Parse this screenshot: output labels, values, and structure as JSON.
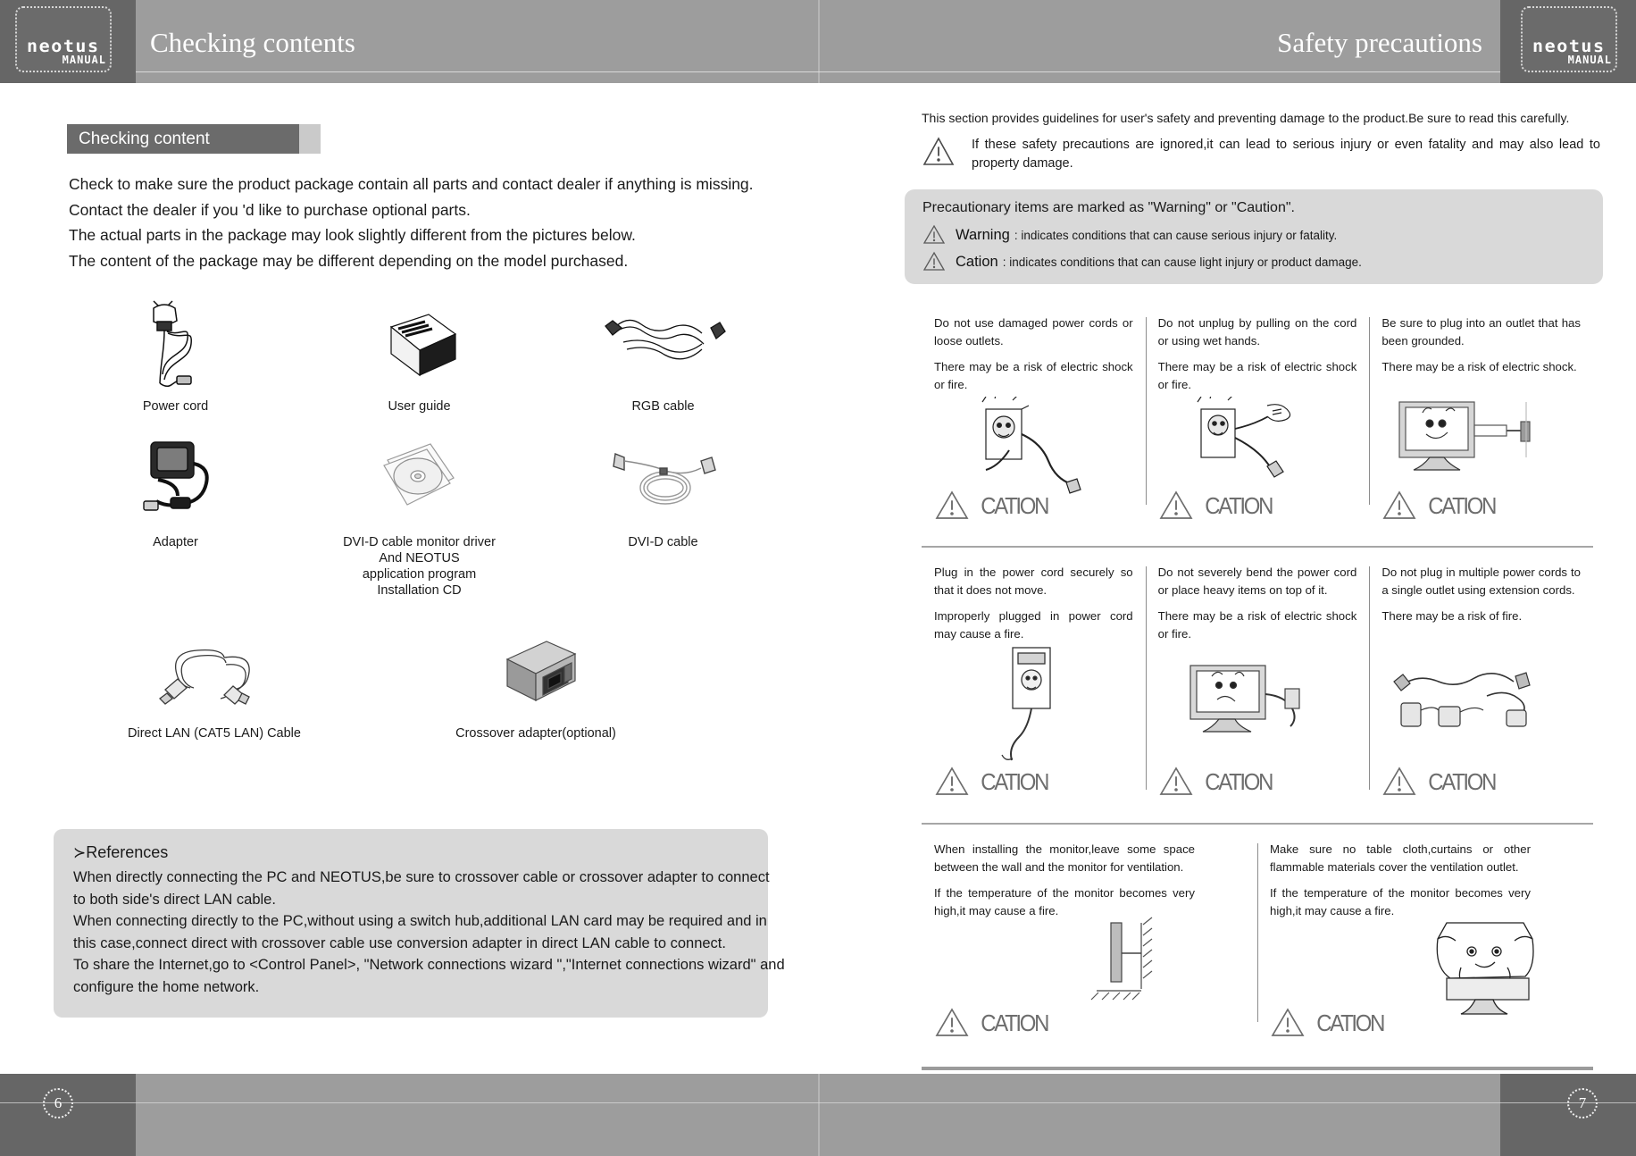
{
  "header": {
    "left_title": "Checking contents",
    "right_title": "Safety precautions",
    "logo_word": "neotus",
    "logo_sub": "MANUAL"
  },
  "footer": {
    "left_page_number": "6",
    "right_page_number": "7"
  },
  "left_page": {
    "section_tab": "Checking content",
    "intro_lines": [
      "Check to make sure the product package contain all parts and contact dealer if anything is missing.",
      "Contact the dealer if you 'd like to purchase optional parts.",
      "The actual parts in the package may look slightly different from the pictures below.",
      "The content of the package may be different depending on the model purchased."
    ],
    "parts": [
      {
        "icon": "power-cord-icon",
        "label": "Power cord"
      },
      {
        "icon": "user-guide-icon",
        "label": "User guide"
      },
      {
        "icon": "rgb-cable-icon",
        "label": "RGB cable"
      },
      {
        "icon": "adapter-icon",
        "label": "Adapter"
      },
      {
        "icon": "cd-disc-icon",
        "label": "DVI-D cable monitor driver\nAnd NEOTUS\napplication program\nInstallation CD"
      },
      {
        "icon": "dvid-cable-icon",
        "label": "DVI-D cable"
      },
      {
        "icon": "lan-cable-icon",
        "label": "Direct LAN (CAT5 LAN) Cable"
      },
      {
        "icon": "crossover-adapter-icon",
        "label": "Crossover adapter(optional)"
      }
    ],
    "references": {
      "title": "References",
      "arrow_glyph": "≻",
      "lines": [
        "When directly connecting the PC and NEOTUS,be sure to crossover cable or crossover adapter to connect",
        "to both side's direct LAN cable.",
        "When connecting directly to the PC,without using a switch hub,additional LAN card may be required and in",
        "this case,connect direct with crossover cable use conversion adapter in direct LAN cable to connect.",
        "To share the Internet,go to <Control Panel>, \"Network connections wizard \",\"Internet connections wizard\" and",
        "configure the home network."
      ]
    }
  },
  "right_page": {
    "intro": "This section provides guidelines for user's safety and preventing damage to the product.Be sure to read this carefully.",
    "warning_note": "If these safety precautions are ignored,it can lead to serious injury or even fatality and may also lead to property damage.",
    "precaution_panel": {
      "heading": "Precautionary items are marked as \"Warning\" or \"Caution\".",
      "items": [
        {
          "term": "Warning",
          "desc": ": indicates conditions that can cause serious injury or fatality."
        },
        {
          "term": "Cation",
          "desc": ": indicates conditions that can cause light injury or product damage."
        }
      ]
    },
    "caution_label": "CATION",
    "caution_cells": [
      {
        "icon": "damaged-cord-outlet-icon",
        "rule": "Do not use damaged power cords or loose outlets.",
        "risk": "There may be a risk of electric shock or fire."
      },
      {
        "icon": "wet-hands-unplug-icon",
        "rule": "Do not unplug by pulling on the cord or using wet hands.",
        "risk": "There may be a risk of electric shock or fire."
      },
      {
        "icon": "grounded-outlet-monitor-icon",
        "rule": "Be sure to plug into an outlet that has been grounded.",
        "risk": "There may be a risk of electric shock."
      },
      {
        "icon": "secure-plug-icon",
        "rule": "Plug in the power cord securely so that it does not move.",
        "risk": "Improperly plugged in power cord may cause a fire."
      },
      {
        "icon": "bent-cord-heavy-item-icon",
        "rule": "Do not severely bend the power cord or place heavy items on top of it.",
        "risk": "There may be a risk of electric shock or fire."
      },
      {
        "icon": "multiple-plugs-extension-icon",
        "rule": "Do not plug in multiple power cords to a single outlet using extension cords.",
        "risk": "There may be a risk of fire."
      },
      {
        "icon": "wall-clearance-icon",
        "rule": "When installing the monitor,leave some space between the wall and the monitor for ventilation.",
        "risk": "If the temperature of the monitor becomes very high,it may cause a fire."
      },
      {
        "icon": "cloth-cover-monitor-icon",
        "rule": "Make sure no table cloth,curtains or other flammable materials cover the ventilation outlet.",
        "risk": "If the temperature of the monitor becomes very high,it may cause a fire."
      }
    ]
  },
  "colors": {
    "header_bar": "#9d9d9d",
    "header_dark": "#666666",
    "tab_dark": "#6b6b6b",
    "panel_gray": "#d9d9d9",
    "caution_gray": "#6d6d6d"
  }
}
